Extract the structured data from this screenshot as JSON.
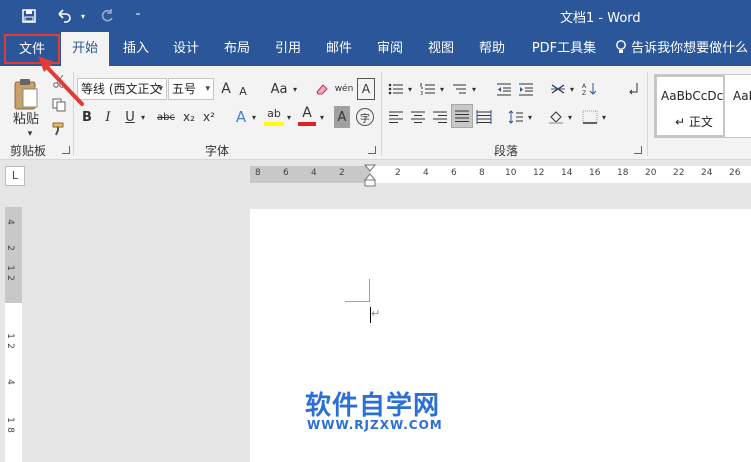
{
  "window": {
    "title": "文档1  -  Word"
  },
  "qat": {
    "save_icon": "save-icon",
    "undo_icon": "undo-icon",
    "redo_icon": "redo-icon",
    "customize_icon": "customize-qat-icon"
  },
  "tabs": [
    {
      "label": "文件"
    },
    {
      "label": "开始"
    },
    {
      "label": "插入"
    },
    {
      "label": "设计"
    },
    {
      "label": "布局"
    },
    {
      "label": "引用"
    },
    {
      "label": "邮件"
    },
    {
      "label": "审阅"
    },
    {
      "label": "视图"
    },
    {
      "label": "帮助"
    },
    {
      "label": "PDF工具集"
    }
  ],
  "tell_me": {
    "label": "告诉我你想要做什么"
  },
  "ribbon": {
    "clipboard": {
      "paste_label": "粘贴",
      "group_label": "剪贴板"
    },
    "font": {
      "font_name": "等线 (西文正文",
      "font_size": "五号",
      "grow_label": "A",
      "shrink_label": "A",
      "case_label": "Aa",
      "pinyin_label": "wén",
      "border_char_label": "A",
      "bold": "B",
      "italic": "I",
      "underline": "U",
      "strike": "abc",
      "subscript": "x₂",
      "superscript": "x²",
      "effects": "A",
      "highlight": "ab",
      "font_color": "A",
      "shade": "A",
      "enclose": "字",
      "group_label": "字体"
    },
    "paragraph": {
      "group_label": "段落"
    },
    "styles": {
      "sample1": "AaBbCcDc",
      "name1": "↵ 正文",
      "sample2": "AaBb"
    }
  },
  "ruler": {
    "corner": "L",
    "h_ticks": [
      "8",
      "6",
      "4",
      "2",
      "2",
      "4",
      "6",
      "8",
      "10",
      "12",
      "14",
      "16",
      "18",
      "20",
      "22",
      "24",
      "26"
    ],
    "v_ticks": [
      "4",
      "2",
      "1",
      "2",
      "1",
      "2",
      "4",
      "1",
      "8"
    ]
  },
  "document": {
    "paragraph_mark": "↵",
    "watermark_title": "软件自学网",
    "watermark_url": "WWW.RJZXW.COM"
  },
  "colors": {
    "brand": "#2b579a",
    "ribbon_bg": "#f3f3f3",
    "highlight_box": "#e53935",
    "watermark": "#2b6fd6"
  }
}
